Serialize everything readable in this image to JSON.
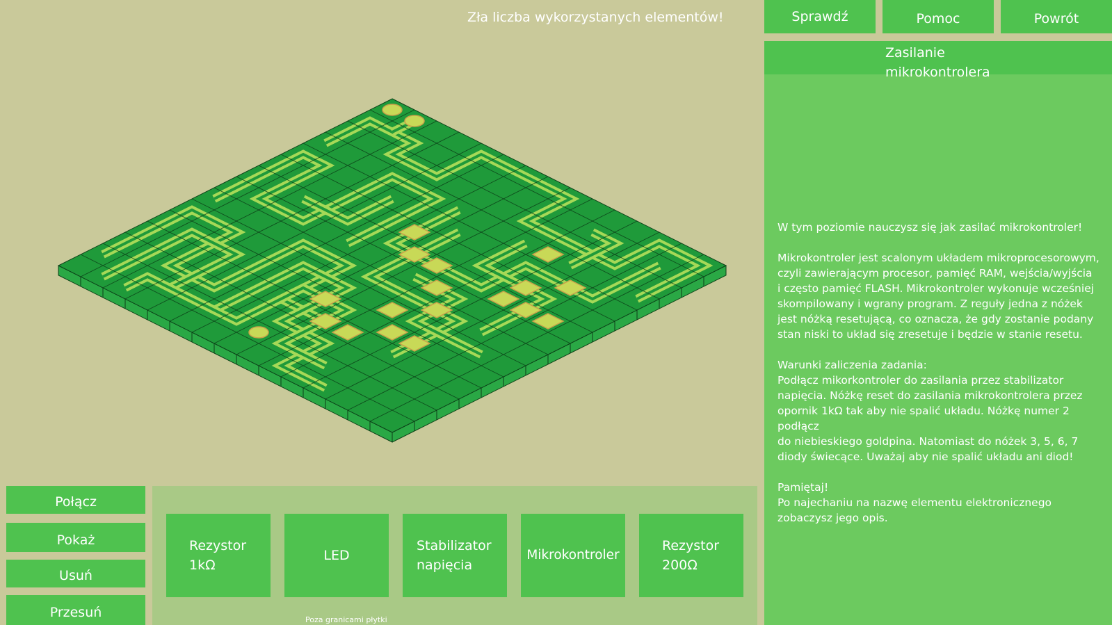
{
  "status_message": "Zła liczba wykorzystanych elementów!",
  "top_buttons": {
    "check": "Sprawdź",
    "help": "Pomoc",
    "back": "Powrót"
  },
  "level": {
    "title": "Zasilanie\nmikrokontrolera",
    "paragraphs": [
      "W tym poziomie nauczysz się jak zasilać mikrokontroler!",
      "Mikrokontroler jest scalonym układem mikroprocesorowym,\nczyli zawierającym procesor, pamięć RAM, wejścia/wyjścia\ni często pamięć FLASH. Mikrokontroler wykonuje wcześniej\nskompilowany i wgrany program. Z reguły jedna z nóżek\njest nóżką resetującą, co oznacza, że gdy zostanie podany\nstan niski to układ się zresetuje i będzie w stanie resetu.",
      "Warunki zaliczenia zadania:\nPodłącz mikorkontroler do zasilania przez stabilizator\nnapięcia. Nóżkę reset do zasilania mikrokontrolera przez\nopornik 1kΩ tak aby nie spalić układu. Nóżkę numer 2 podłącz\ndo niebieskiego goldpina. Natomiast do nóżek 3, 5, 6, 7\ndiody świecące. Uważaj aby nie spalić układu ani diod!",
      "Pamiętaj!\nPo najechaniu na nazwę elementu elektronicznego\nzobaczysz jego opis."
    ]
  },
  "tools": {
    "connect": "Połącz",
    "show": "Pokaż",
    "remove": "Usuń",
    "move": "Przesuń"
  },
  "parts": [
    {
      "label": "Rezystor\n1kΩ"
    },
    {
      "label": "LED"
    },
    {
      "label": "Stabilizator\nnapięcia"
    },
    {
      "label": "Mikrokontroler"
    },
    {
      "label": "Rezystor\n200Ω"
    }
  ],
  "hint": "Poza granicami płytki",
  "colors": {
    "background": "#c9c99a",
    "button": "#4fc24f",
    "panel": "#6cca5f",
    "tray": "#a9c986",
    "board": "#1f9a3a",
    "trace": "#a6d957",
    "pad": "#c8d957"
  }
}
